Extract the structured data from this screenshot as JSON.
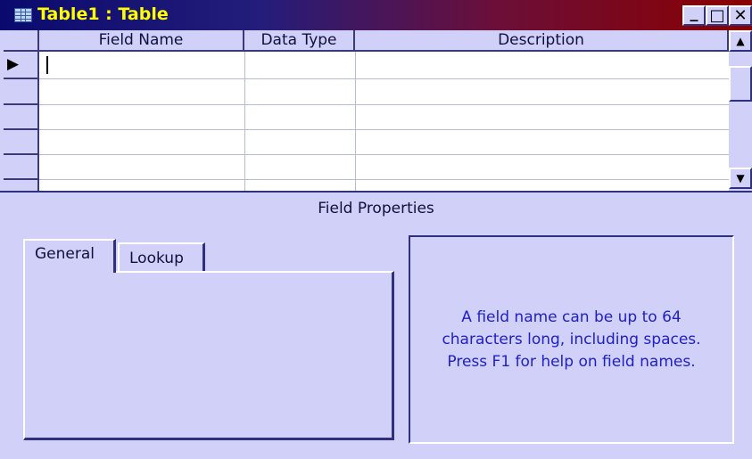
{
  "window": {
    "title": "Table1 : Table",
    "title_color": "#ffff00"
  },
  "title_buttons": {
    "minimize": "_",
    "maximize": "□",
    "close": "✕"
  },
  "grid": {
    "columns": [
      "Field Name",
      "Data Type",
      "Description"
    ],
    "current_row_marker": "▶"
  },
  "section": {
    "label": "Field Properties"
  },
  "tabs": [
    {
      "label": "General",
      "active": true
    },
    {
      "label": "Lookup",
      "active": false
    }
  ],
  "help": {
    "text": "A field name can be up to 64\ncharacters long, including spaces.\n Press F1 for help on field names."
  },
  "colors": {
    "background": "#d0d0f8",
    "help_text": "#2020c8",
    "dark_edge": "#303080"
  }
}
